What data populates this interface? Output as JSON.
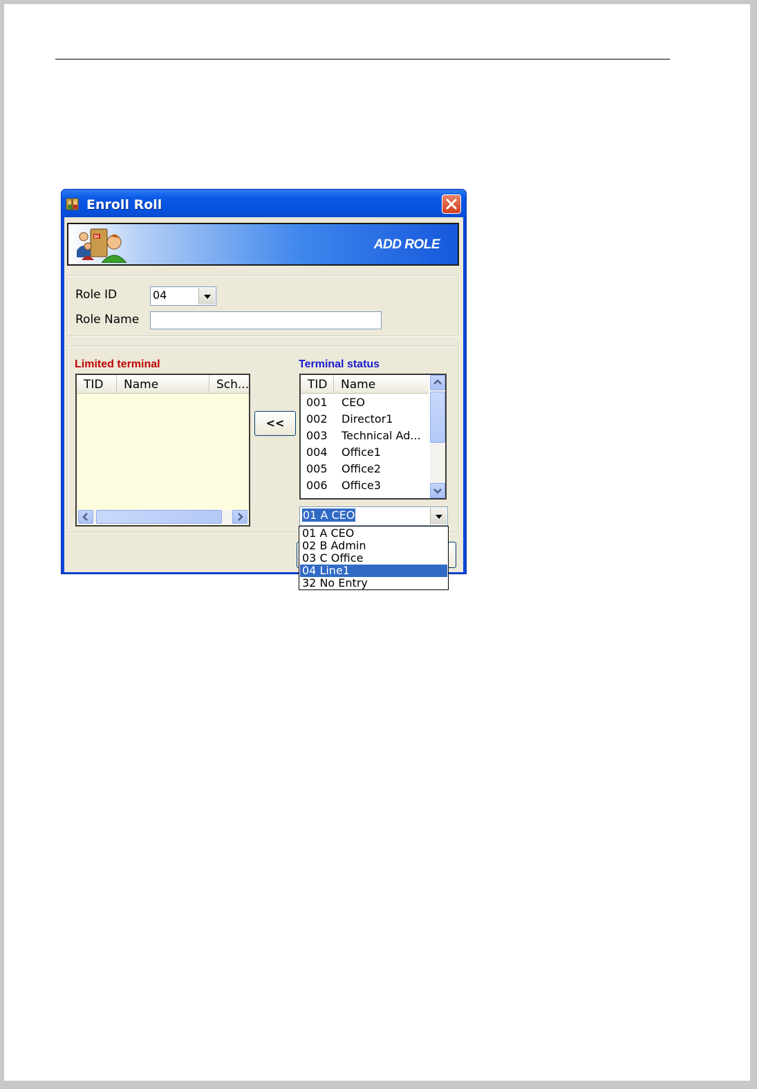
{
  "window": {
    "title": "Enroll Roll",
    "banner_title": "ADD ROLE"
  },
  "form": {
    "role_id_label": "Role ID",
    "role_id_value": "04",
    "role_name_label": "Role Name",
    "role_name_value": ""
  },
  "limited_terminal": {
    "heading": "Limited terminal",
    "columns": [
      "TID",
      "Name",
      "Sch..."
    ],
    "rows": []
  },
  "move_button_label": "<<",
  "terminal_status": {
    "heading": "Terminal status",
    "columns": [
      "TID",
      "Name"
    ],
    "rows": [
      {
        "tid": "001",
        "name": "CEO"
      },
      {
        "tid": "002",
        "name": "Director1"
      },
      {
        "tid": "003",
        "name": "Technical Ad..."
      },
      {
        "tid": "004",
        "name": "Office1"
      },
      {
        "tid": "005",
        "name": "Office2"
      },
      {
        "tid": "006",
        "name": "Office3"
      }
    ]
  },
  "schedule_combo": {
    "value": "01 A CEO",
    "options": [
      "01 A CEO",
      "02 B Admin",
      "03 C Office",
      "04 Line1",
      "32 No Entry"
    ],
    "highlighted_option": "04 Line1"
  },
  "colors": {
    "limited_heading": "#c00000",
    "status_heading": "#1a1ad0",
    "title_bar": "#0552e0",
    "selection": "#316ac5"
  },
  "icons": [
    "app-icon",
    "close-icon",
    "enroll-role-banner-icon",
    "scroll-up-icon",
    "scroll-down-icon",
    "scroll-left-icon",
    "scroll-right-icon",
    "dropdown-arrow-icon"
  ]
}
